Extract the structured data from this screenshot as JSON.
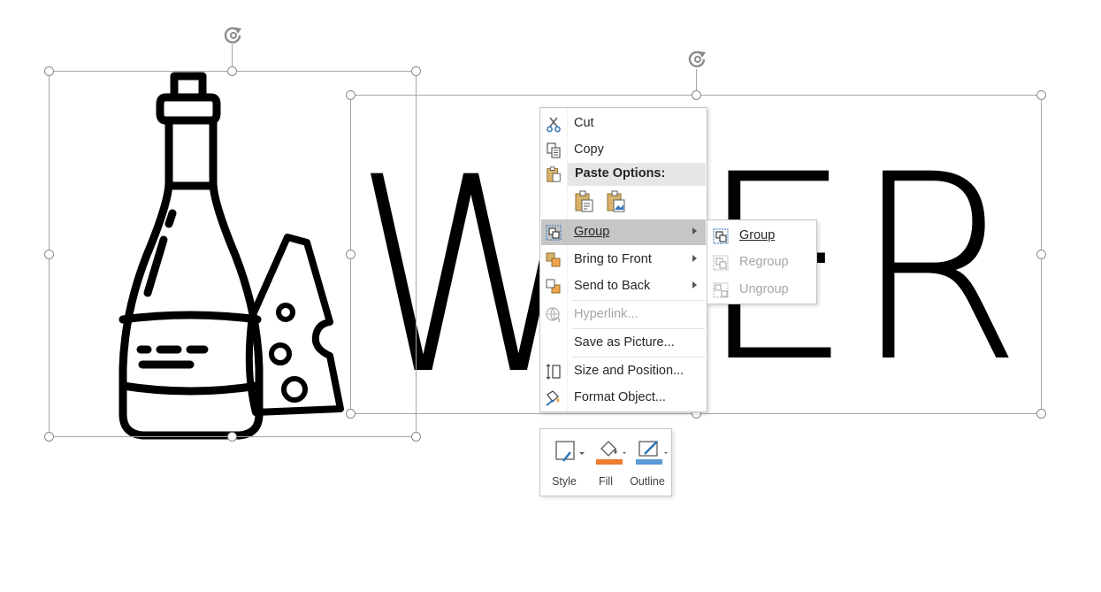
{
  "canvas": {
    "wordart_text_left": "W",
    "wordart_text_right": "ER"
  },
  "context_menu": {
    "items": [
      {
        "label": "Cut",
        "icon": "scissors-icon",
        "enabled": true
      },
      {
        "label": "Copy",
        "icon": "copy-icon",
        "enabled": true
      },
      {
        "label": "Paste Options:",
        "icon": "clipboard-icon",
        "header": true
      },
      {
        "label": "Group",
        "icon": "group-icon",
        "enabled": true,
        "submenu": true,
        "highlighted": true
      },
      {
        "label": "Bring to Front",
        "icon": "bring-to-front-icon",
        "enabled": true,
        "submenu": true
      },
      {
        "label": "Send to Back",
        "icon": "send-to-back-icon",
        "enabled": true,
        "submenu": true
      },
      {
        "label": "Hyperlink...",
        "icon": "hyperlink-icon",
        "enabled": false
      },
      {
        "label": "Save as Picture...",
        "enabled": true
      },
      {
        "label": "Size and Position...",
        "icon": "size-position-icon",
        "enabled": true
      },
      {
        "label": "Format Object...",
        "icon": "format-object-icon",
        "enabled": true
      }
    ],
    "paste_options": [
      "keep-text-only-icon",
      "picture-paste-icon"
    ]
  },
  "group_submenu": {
    "items": [
      {
        "label": "Group",
        "icon": "group-icon",
        "enabled": true
      },
      {
        "label": "Regroup",
        "icon": "regroup-icon",
        "enabled": false
      },
      {
        "label": "Ungroup",
        "icon": "ungroup-icon",
        "enabled": false
      }
    ]
  },
  "mini_toolbar": {
    "style_label": "Style",
    "fill_label": "Fill",
    "outline_label": "Outline",
    "fill_color": "#ed7d31",
    "outline_color": "#5b9bd5"
  }
}
